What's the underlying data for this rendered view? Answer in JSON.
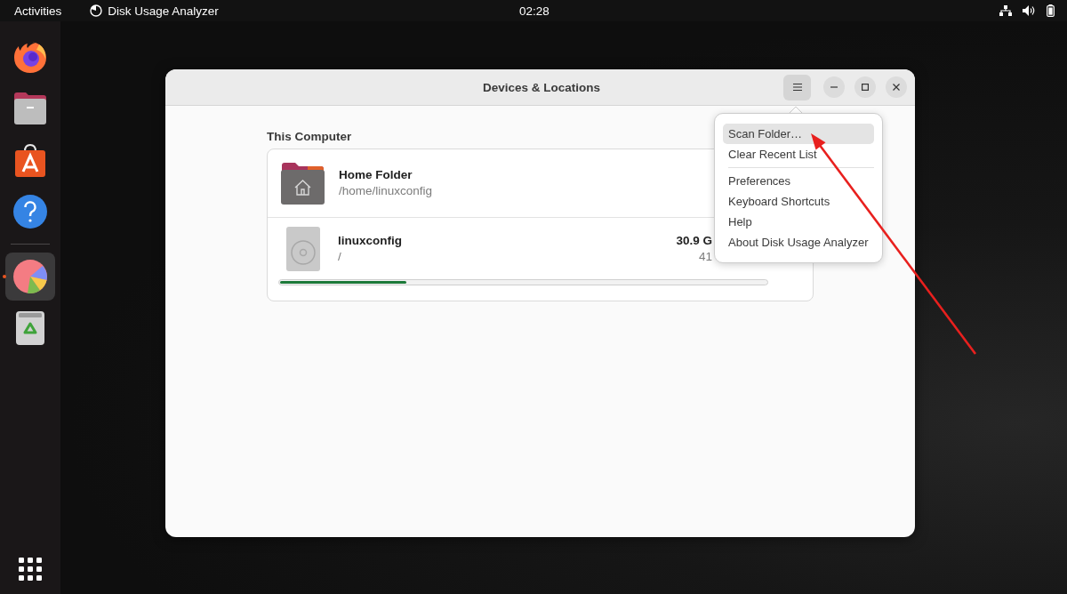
{
  "top_bar": {
    "activities": "Activities",
    "app_name": "Disk Usage Analyzer",
    "clock": "02:28"
  },
  "dock": {
    "groups": [
      [
        {
          "kind": "browser",
          "selected": false,
          "running": false
        },
        {
          "kind": "files",
          "selected": false,
          "running": false
        },
        {
          "kind": "software",
          "selected": false,
          "running": false
        },
        {
          "kind": "help",
          "selected": false,
          "running": false
        }
      ],
      [
        {
          "kind": "analyzer",
          "selected": true,
          "running": true
        },
        {
          "kind": "trash",
          "selected": false,
          "running": false
        }
      ]
    ]
  },
  "window": {
    "title": "Devices & Locations",
    "menu_button": {
      "pressed": true
    },
    "section_title": "This Computer",
    "locations": [
      {
        "kind": "folder",
        "name": "Home Folder",
        "path": "/home/linuxconfig"
      },
      {
        "kind": "drive",
        "name": "linuxconfig",
        "path": "/",
        "size": "30.9 G",
        "free": "41",
        "level": 0.26
      }
    ]
  },
  "menu": {
    "sections": [
      [
        {
          "label": "Scan Folder…",
          "selected": true
        },
        {
          "label": "Clear Recent List",
          "selected": false
        }
      ],
      [
        {
          "label": "Preferences",
          "selected": false
        },
        {
          "label": "Keyboard Shortcuts",
          "selected": false
        },
        {
          "label": "Help",
          "selected": false
        },
        {
          "label": "About Disk Usage Analyzer",
          "selected": false
        }
      ]
    ]
  }
}
